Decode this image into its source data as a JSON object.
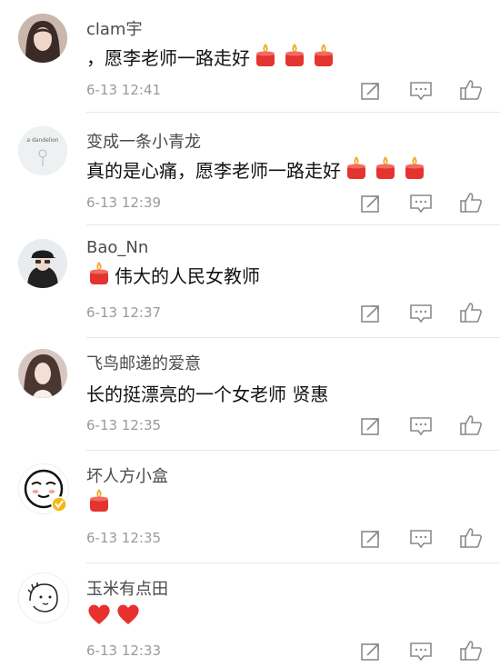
{
  "comments": [
    {
      "username": "clam宇",
      "text": "，愿李老师一路走好",
      "emojis": [
        "candle",
        "candle",
        "candle"
      ],
      "time": "6-13 12:41",
      "avatar": "portrait-girl-1"
    },
    {
      "username": "变成一条小青龙",
      "text": "真的是心痛，愿李老师一路走好",
      "emojis": [
        "candle",
        "candle",
        "candle"
      ],
      "time": "6-13 12:39",
      "avatar": "dandelion-illustration"
    },
    {
      "username": "Bao_Nn",
      "text": "伟大的人民女教师",
      "emojis_before": [
        "candle"
      ],
      "emojis": [],
      "time": "6-13 12:37",
      "avatar": "portrait-cap"
    },
    {
      "username": "飞鸟邮递的爱意",
      "text": "长的挺漂亮的一个女老师 贤惠",
      "emojis": [],
      "time": "6-13 12:35",
      "avatar": "portrait-girl-2"
    },
    {
      "username": "坏人方小盒",
      "text": "",
      "emojis": [
        "candle"
      ],
      "time": "6-13 12:35",
      "avatar": "cartoon-face-verified"
    },
    {
      "username": "玉米有点田",
      "text": "",
      "emojis": [
        "heart",
        "heart"
      ],
      "time": "6-13 12:33",
      "avatar": "sketch-character"
    }
  ],
  "colors": {
    "username": "#4a4a4a",
    "text": "#111111",
    "timestamp": "#9a9a9a",
    "icon": "#8a8a8a",
    "candle_red": "#e3342f",
    "flame": "#f5a623",
    "heart": "#e8312f",
    "divider": "#e6e6e6"
  }
}
